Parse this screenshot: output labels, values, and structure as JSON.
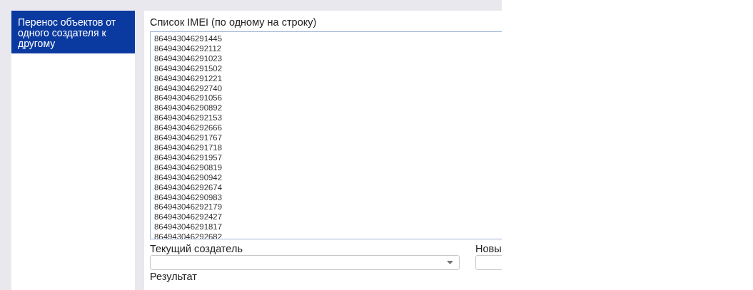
{
  "sidebar": {
    "items": [
      {
        "label": "Перенос объектов от одного создателя к другому",
        "selected": true
      }
    ]
  },
  "imei_list": {
    "label": "Список IMEI (по одному на строку)",
    "lines": [
      "864943046291445",
      "864943046292112",
      "864943046291023",
      "864943046291502",
      "864943046291221",
      "864943046292740",
      "864943046291056",
      "864943046290892",
      "864943046292153",
      "864943046292666",
      "864943046291767",
      "864943046291718",
      "864943046291957",
      "864943046290819",
      "864943046290942",
      "864943046292674",
      "864943046290983",
      "864943046292179",
      "864943046292427",
      "864943046291817",
      "864943046292682"
    ]
  },
  "current_creator": {
    "label": "Текущий создатель"
  },
  "new_creator": {
    "label": "Новы"
  },
  "result": {
    "label": "Результат"
  }
}
